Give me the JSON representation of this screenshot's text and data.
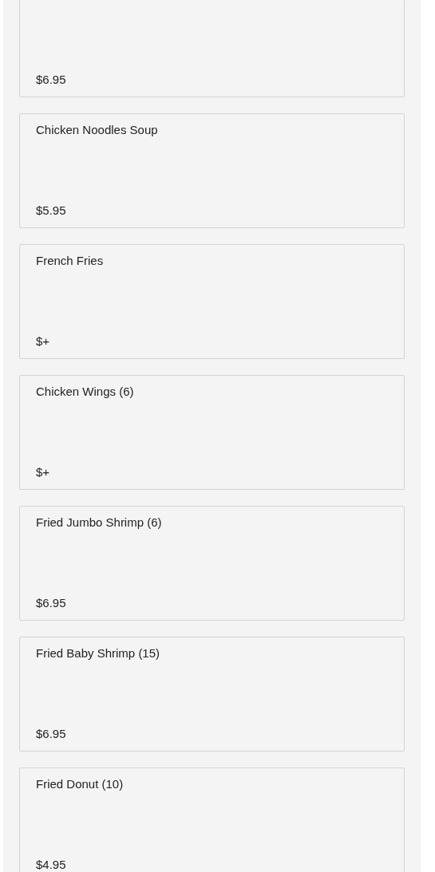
{
  "menu_items": [
    {
      "price": "$6.95"
    },
    {
      "name": "Chicken Noodles Soup",
      "price": "$5.95"
    },
    {
      "name": "French Fries",
      "price": "$+"
    },
    {
      "name": "Chicken Wings (6)",
      "price": "$+"
    },
    {
      "name": "Fried Jumbo Shrimp (6)",
      "price": "$6.95"
    },
    {
      "name": "Fried Baby Shrimp (15)",
      "price": "$6.95"
    },
    {
      "name": "Fried Donut (10)",
      "price": "$4.95"
    }
  ]
}
